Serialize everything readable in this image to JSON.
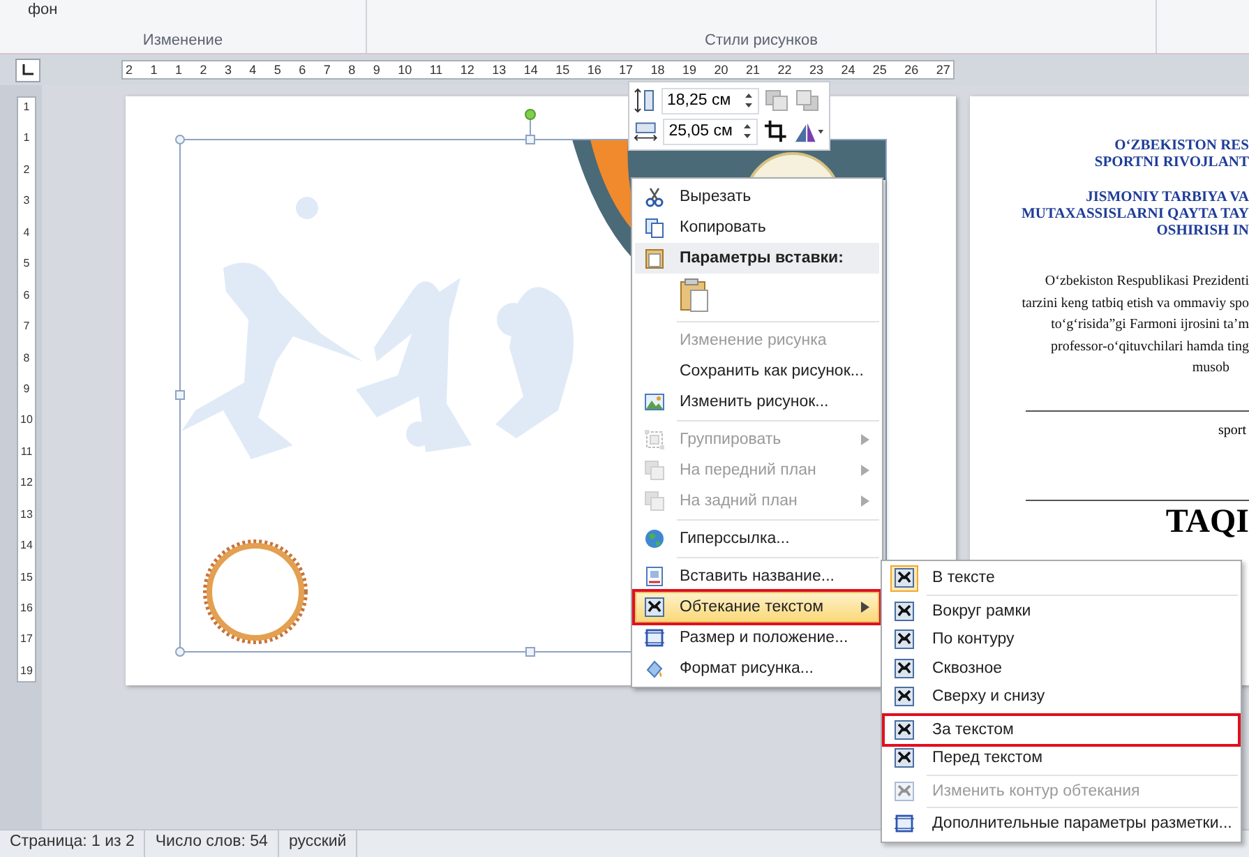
{
  "ribbon": {
    "partial_label": "фон",
    "groups": [
      {
        "label": "Изменение"
      },
      {
        "label": "Стили рисунков"
      }
    ]
  },
  "horizontal_ruler": [
    "2",
    "1",
    "1",
    "2",
    "3",
    "4",
    "5",
    "6",
    "7",
    "8",
    "9",
    "10",
    "11",
    "12",
    "13",
    "14",
    "15",
    "16",
    "17",
    "18",
    "19",
    "20",
    "21",
    "22",
    "23",
    "24",
    "25",
    "26",
    "27"
  ],
  "vertical_ruler": [
    "1",
    "1",
    "2",
    "3",
    "4",
    "5",
    "6",
    "7",
    "8",
    "9",
    "10",
    "11",
    "12",
    "13",
    "14",
    "15",
    "16",
    "17",
    "19"
  ],
  "size_toolbar": {
    "height": "18,25 см",
    "width": "25,05 см"
  },
  "context_menu": {
    "items": [
      {
        "kind": "item",
        "label": "Вырезать",
        "disabled": false,
        "submenu": false,
        "selected": false,
        "outlined": false
      },
      {
        "kind": "item",
        "label": "Копировать",
        "disabled": false,
        "submenu": false,
        "selected": false,
        "outlined": false
      },
      {
        "kind": "header",
        "label": "Параметры вставки:",
        "disabled": false,
        "submenu": false,
        "selected": false,
        "outlined": false
      },
      {
        "kind": "paste",
        "disabled": false,
        "submenu": false,
        "selected": false,
        "outlined": false
      },
      {
        "kind": "separator"
      },
      {
        "kind": "item",
        "label": "Изменение рисунка",
        "disabled": true,
        "submenu": false,
        "selected": false,
        "outlined": false
      },
      {
        "kind": "item",
        "label": "Сохранить как рисунок...",
        "disabled": false,
        "submenu": false,
        "selected": false,
        "outlined": false
      },
      {
        "kind": "item",
        "label": "Изменить рисунок...",
        "disabled": false,
        "submenu": false,
        "selected": false,
        "outlined": false
      },
      {
        "kind": "separator"
      },
      {
        "kind": "item",
        "label": "Группировать",
        "disabled": true,
        "submenu": true,
        "selected": false,
        "outlined": false
      },
      {
        "kind": "item",
        "label": "На передний план",
        "disabled": true,
        "submenu": true,
        "selected": false,
        "outlined": false
      },
      {
        "kind": "item",
        "label": "На задний план",
        "disabled": true,
        "submenu": true,
        "selected": false,
        "outlined": false
      },
      {
        "kind": "separator"
      },
      {
        "kind": "item",
        "label": "Гиперссылка...",
        "disabled": false,
        "submenu": false,
        "selected": false,
        "outlined": false
      },
      {
        "kind": "separator"
      },
      {
        "kind": "item",
        "label": "Вставить название...",
        "disabled": false,
        "submenu": false,
        "selected": false,
        "outlined": false
      },
      {
        "kind": "item",
        "label": "Обтекание текстом",
        "disabled": false,
        "submenu": true,
        "selected": true,
        "outlined": true
      },
      {
        "kind": "item",
        "label": "Размер и положение...",
        "disabled": false,
        "submenu": false,
        "selected": false,
        "outlined": false
      },
      {
        "kind": "item",
        "label": "Формат рисунка...",
        "disabled": false,
        "submenu": false,
        "selected": false,
        "outlined": false
      }
    ]
  },
  "wrap_submenu": {
    "items": [
      {
        "kind": "item",
        "label": "В тексте",
        "checked": true,
        "disabled": false,
        "outlined": false
      },
      {
        "kind": "separator"
      },
      {
        "kind": "item",
        "label": "Вокруг рамки",
        "checked": false,
        "disabled": false,
        "outlined": false
      },
      {
        "kind": "item",
        "label": "По контуру",
        "checked": false,
        "disabled": false,
        "outlined": false
      },
      {
        "kind": "item",
        "label": "Сквозное",
        "checked": false,
        "disabled": false,
        "outlined": false
      },
      {
        "kind": "item",
        "label": "Сверху и снизу",
        "checked": false,
        "disabled": false,
        "outlined": false
      },
      {
        "kind": "separator"
      },
      {
        "kind": "item",
        "label": "За текстом",
        "checked": false,
        "disabled": false,
        "outlined": true
      },
      {
        "kind": "item",
        "label": "Перед текстом",
        "checked": false,
        "disabled": false,
        "outlined": false
      },
      {
        "kind": "separator"
      },
      {
        "kind": "item",
        "label": "Изменить контур обтекания",
        "checked": false,
        "disabled": true,
        "outlined": false
      },
      {
        "kind": "separator"
      },
      {
        "kind": "item",
        "label": "Дополнительные параметры разметки...",
        "checked": false,
        "disabled": false,
        "outlined": false
      }
    ]
  },
  "document_page_2": {
    "heading_lines": [
      "O‘ZBEKISTON RES",
      "SPORTNI RIVOJLANT",
      "JISMONIY TARBIYA VA",
      "MUTAXASSISLARNI QAYTA TAY",
      "OSHIRISH IN"
    ],
    "body_lines": [
      "O‘zbekiston Respublikasi Prezidenti",
      "tarzini keng tatbiq etish va ommaviy spo",
      "to‘g‘risida”gi Farmoni ijrosini  ta’m",
      "professor-o‘qituvchilari  hamda ting",
      "musob"
    ],
    "caption": "sport",
    "title": "TAQI"
  },
  "status_bar": [
    "Страница: 1 из 2",
    "Число слов: 54",
    "русский"
  ]
}
